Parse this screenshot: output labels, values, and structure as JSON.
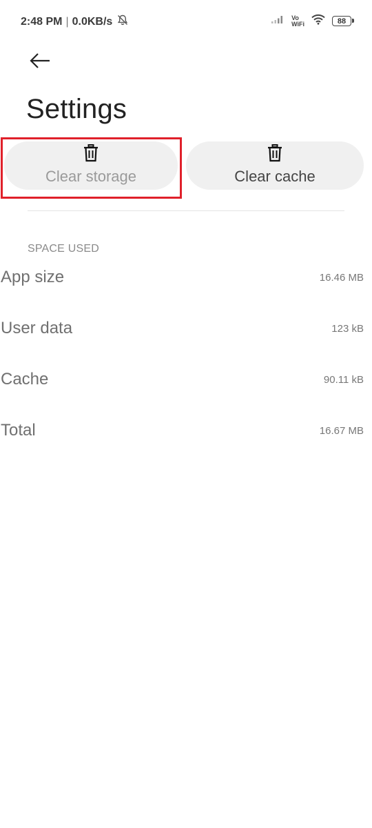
{
  "status_bar": {
    "time": "2:48 PM",
    "separator": "|",
    "net_speed": "0.0KB/s",
    "vowifi_top": "Vo",
    "vowifi_bottom": "WiFi",
    "battery": "88",
    "icons": [
      "bell-muted-icon",
      "signal-icon",
      "wifi-icon",
      "battery-icon"
    ]
  },
  "header": {
    "back_icon": "back-arrow-icon",
    "title": "Settings"
  },
  "actions": {
    "clear_storage": {
      "label": "Clear storage",
      "icon": "trash-icon",
      "state": "disabled"
    },
    "clear_cache": {
      "label": "Clear cache",
      "icon": "trash-icon"
    }
  },
  "space_used": {
    "header": "SPACE USED",
    "rows": [
      {
        "label": "App size",
        "value": "16.46 MB"
      },
      {
        "label": "User data",
        "value": "123 kB"
      },
      {
        "label": "Cache",
        "value": "90.11 kB"
      },
      {
        "label": "Total",
        "value": "16.67 MB"
      }
    ]
  },
  "colors": {
    "highlight": "#e0202a",
    "button_bg": "#f0f0f0",
    "disabled_text": "#9a9a9a"
  }
}
